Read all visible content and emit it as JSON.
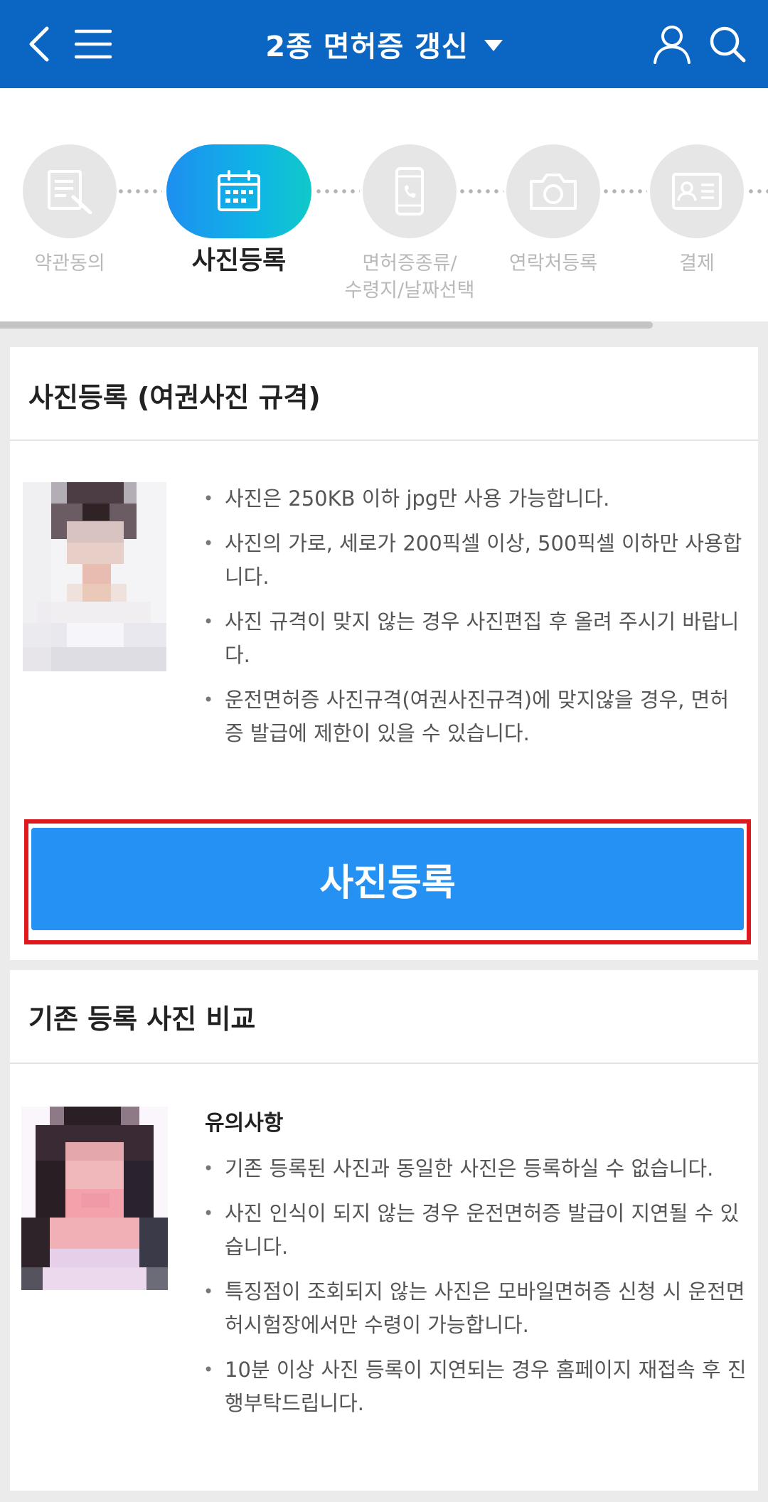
{
  "header": {
    "title": "2종 면허증 갱신"
  },
  "steps": [
    {
      "label": "약관동의",
      "icon": "document-edit-icon",
      "active": false
    },
    {
      "label": "사진등록",
      "icon": "calendar-icon",
      "active": true
    },
    {
      "label": "면허증종류/\n수령지/날짜선택",
      "icon": "phone-icon",
      "active": false
    },
    {
      "label": "연락처등록",
      "icon": "camera-icon",
      "active": false
    },
    {
      "label": "결제",
      "icon": "id-card-icon",
      "active": false
    }
  ],
  "progress_percent": 85,
  "photo_section": {
    "title": "사진등록 (여권사진 규격)",
    "bullets": [
      "사진은 250KB 이하 jpg만 사용 가능합니다.",
      "사진의 가로, 세로가 200픽셀 이상, 500픽셀 이하만 사용합니다.",
      "사진 규격이 맞지 않는 경우 사진편집 후 올려 주시기 바랍니다.",
      "운전면허증 사진규격(여권사진규격)에 맞지않을 경우, 면허증 발급에 제한이 있을 수 있습니다."
    ],
    "button_label": "사진등록"
  },
  "compare_section": {
    "title": "기존 등록 사진 비교",
    "notice_title": "유의사항",
    "bullets": [
      "기존 등록된 사진과 동일한 사진은 등록하실 수 없습니다.",
      "사진 인식이 되지 않는 경우 운전면허증 발급이 지연될 수 있습니다.",
      "특징점이 조회되지 않는 사진은 모바일면허증 신청 시 운전면허시험장에서만 수령이 가능합니다.",
      "10분 이상 사진 등록이 지연되는 경우 홈페이지 재접속 후 진행부탁드립니다."
    ]
  },
  "colors": {
    "header_bg": "#0a66c2",
    "button_bg": "#2591f2",
    "highlight_border": "#e0191e"
  }
}
